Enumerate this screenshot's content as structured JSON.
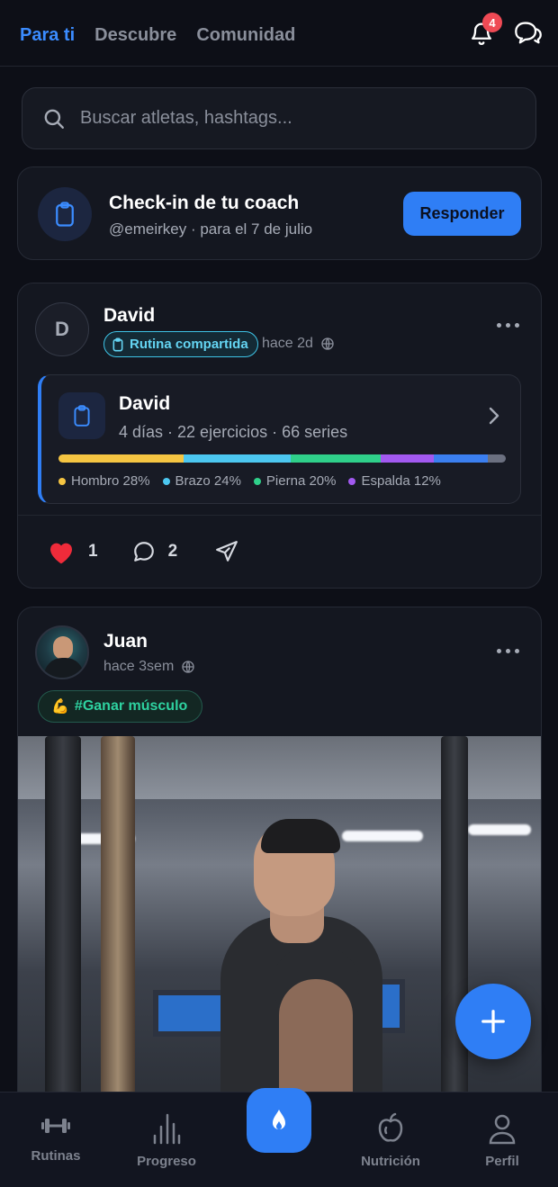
{
  "header": {
    "tabs": [
      {
        "label": "Para ti",
        "active": true
      },
      {
        "label": "Descubre",
        "active": false
      },
      {
        "label": "Comunidad",
        "active": false
      }
    ],
    "notifications_count": "4"
  },
  "search": {
    "placeholder": "Buscar atletas, hashtags..."
  },
  "checkin": {
    "title": "Check-in de tu coach",
    "subtitle": "@emeirkey · para el 7 de julio",
    "button_label": "Responder"
  },
  "post1": {
    "avatar_letter": "D",
    "author": "David",
    "badge": "Rutina compartida",
    "time": "hace 2d",
    "routine": {
      "title": "David",
      "summary": "4 días · 22 ejercicios · 66 series",
      "distribution": [
        {
          "label": "Hombro 28%",
          "percent": 28,
          "color": "#f5c542"
        },
        {
          "label": "Brazo 24%",
          "percent": 24,
          "color": "#4cc7f0"
        },
        {
          "label": "Pierna 20%",
          "percent": 20,
          "color": "#2fd08a"
        },
        {
          "label": "Espalda 12%",
          "percent": 12,
          "color": "#a259f0"
        },
        {
          "label": "",
          "percent": 12,
          "color": "#3b7ff0"
        },
        {
          "label": "",
          "percent": 4,
          "color": "#6b7080"
        }
      ]
    },
    "likes": "1",
    "comments": "2"
  },
  "post2": {
    "author": "Juan",
    "time": "hace 3sem",
    "tag_emoji": "💪",
    "tag": "#Ganar músculo"
  },
  "bottom_nav": {
    "items": [
      {
        "label": "Rutinas"
      },
      {
        "label": "Progreso"
      },
      {
        "label": "Nutrición"
      },
      {
        "label": "Perfil"
      }
    ]
  },
  "colors": {
    "accent": "#2f7ef5",
    "background": "#0d0f17",
    "card": "#141720"
  }
}
